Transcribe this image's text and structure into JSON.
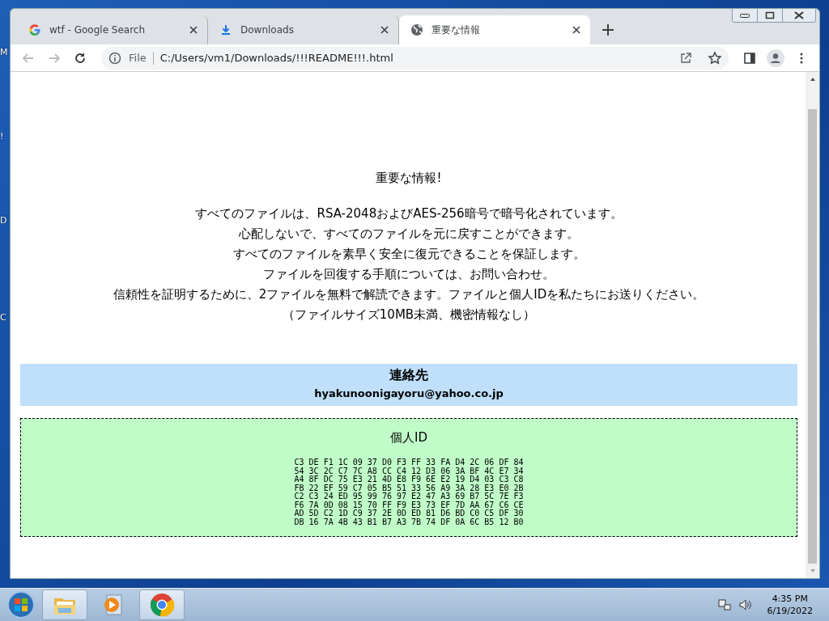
{
  "desktop_fragments": [
    "M",
    "!",
    "D",
    "C"
  ],
  "window": {
    "tabs": [
      {
        "title": "wtf - Google Search",
        "kind": "google",
        "selected": false
      },
      {
        "title": "Downloads",
        "kind": "download",
        "selected": false
      },
      {
        "title": "重要な情報",
        "kind": "globe",
        "selected": true
      }
    ],
    "address": {
      "scheme": "File",
      "url": "C:/Users/vm1/Downloads/!!!README!!!.html"
    }
  },
  "page": {
    "heading": "重要な情報!",
    "lines": [
      "すべてのファイルは、RSA-2048およびAES-256暗号で暗号化されています。",
      "心配しないで、すべてのファイルを元に戻すことができます。",
      "すべてのファイルを素早く安全に復元できることを保証します。",
      "ファイルを回復する手順については、お問い合わせ。",
      "信頼性を証明するために、2ファイルを無料で解読できます。ファイルと個人IDを私たちにお送りください。",
      "（ファイルサイズ10MB未満、機密情報なし）"
    ],
    "contact": {
      "heading": "連絡先",
      "email": "hyakunoonigayoru@yahoo.co.jp"
    },
    "personal_id": {
      "heading": "個人ID",
      "lines": [
        "C3 DE F1 1C 09 37 D0 F3 FF 33 FA D4 2C 06 DF 84",
        "54 3C 2C C7 7C A8 CC C4 12 D3 06 3A BF 4C E7 34",
        "A4 8F DC 75 E3 21 4D E8 F9 6E E2 19 D4 03 C3 C8",
        "FB 22 EF 59 C7 05 B5 51 33 56 A9 3A 28 E3 E0 2B",
        "C2 C3 24 ED 95 99 76 97 E2 47 A3 69 B7 5C 7E F3",
        "F6 7A 0D 08 15 70 FF F9 E3 73 EF 7D AA 67 C6 CE",
        "AD 5D C2 1D C9 37 2E 0D ED 81 D6 BD C0 C5 DF 30",
        "DB 16 7A 4B 43 B1 B7 A3 7B 74 DF 0A 6C B5 12 B0"
      ]
    }
  },
  "taskbar": {
    "items": [
      {
        "kind": "folder",
        "running": true
      },
      {
        "kind": "media",
        "running": false
      },
      {
        "kind": "chrome",
        "running": true
      }
    ],
    "time": "4:35 PM",
    "date": "6/19/2022"
  }
}
